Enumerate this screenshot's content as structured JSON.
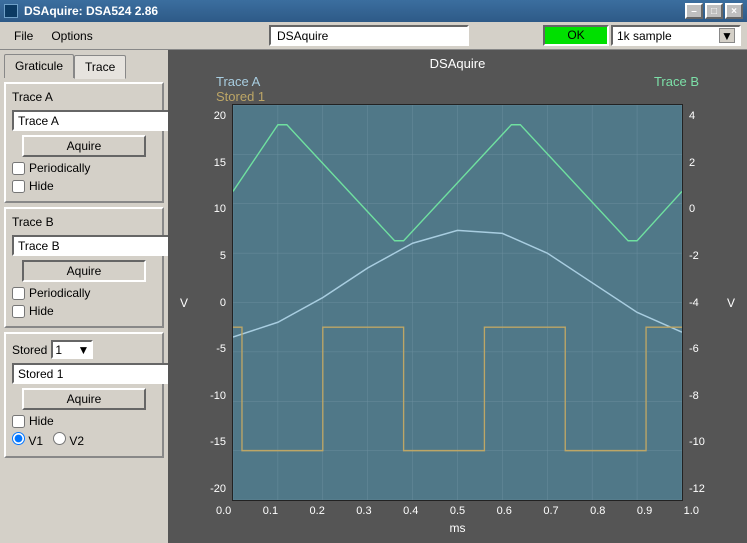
{
  "window": {
    "title": "DSAquire: DSA524 2.86"
  },
  "menu": {
    "file": "File",
    "options": "Options"
  },
  "top": {
    "input_value": "DSAquire",
    "ok": "OK",
    "sample_mode": "1k sample"
  },
  "tabs": {
    "graticule": "Graticule",
    "trace": "Trace"
  },
  "traceA": {
    "title": "Trace A",
    "value": "Trace A",
    "color": "#a8cde0",
    "acquire": "Aquire",
    "periodically": "Periodically",
    "hide": "Hide"
  },
  "traceB": {
    "title": "Trace B",
    "value": "Trace B",
    "color": "#6fe0a0",
    "acquire": "Aquire",
    "periodically": "Periodically",
    "hide": "Hide"
  },
  "stored": {
    "title": "Stored",
    "index": "1",
    "value": "Stored 1",
    "color": "#bda666",
    "acquire": "Aquire",
    "hide": "Hide",
    "v1": "V1",
    "v2": "V2"
  },
  "plot": {
    "title": "DSAquire",
    "legend_a": "Trace A",
    "legend_s1": "Stored 1",
    "legend_b": "Trace B",
    "xlabel": "ms",
    "ylabel_left": "V",
    "ylabel_right": "V"
  },
  "chart_data": {
    "type": "line",
    "xlabel": "ms",
    "x_ticks": [
      0.0,
      0.1,
      0.2,
      0.3,
      0.4,
      0.5,
      0.6,
      0.7,
      0.8,
      0.9,
      1.0
    ],
    "left_axis": {
      "label": "V",
      "ticks": [
        20,
        15,
        10,
        5,
        0,
        -5,
        -10,
        -15,
        -20
      ]
    },
    "right_axis": {
      "label": "V",
      "ticks": [
        4,
        2,
        0,
        -2,
        -4,
        -6,
        -8,
        -10,
        -12
      ]
    },
    "series": [
      {
        "name": "Trace A",
        "axis": "left",
        "color": "#a8cde0",
        "x": [
          0.0,
          0.1,
          0.2,
          0.3,
          0.4,
          0.5,
          0.6,
          0.7,
          0.8,
          0.9,
          1.0
        ],
        "y": [
          -3.5,
          -2.0,
          0.5,
          3.5,
          6.0,
          7.3,
          7.0,
          5.0,
          2.0,
          -1.0,
          -3.0
        ]
      },
      {
        "name": "Trace B",
        "axis": "right",
        "color": "#6fe0a0",
        "x": [
          0.0,
          0.1,
          0.12,
          0.36,
          0.38,
          0.62,
          0.64,
          0.88,
          0.9,
          1.0
        ],
        "y": [
          0.5,
          3.2,
          3.2,
          -1.5,
          -1.5,
          3.2,
          3.2,
          -1.5,
          -1.5,
          0.5
        ]
      },
      {
        "name": "Stored 1",
        "axis": "right",
        "color": "#bda666",
        "x": [
          0.0,
          0.02,
          0.02,
          0.2,
          0.2,
          0.38,
          0.38,
          0.56,
          0.56,
          0.74,
          0.74,
          0.92,
          0.92,
          1.0
        ],
        "y": [
          -5.0,
          -5.0,
          -10.0,
          -10.0,
          -5.0,
          -5.0,
          -10.0,
          -10.0,
          -5.0,
          -5.0,
          -10.0,
          -10.0,
          -5.0,
          -5.0
        ]
      }
    ]
  }
}
